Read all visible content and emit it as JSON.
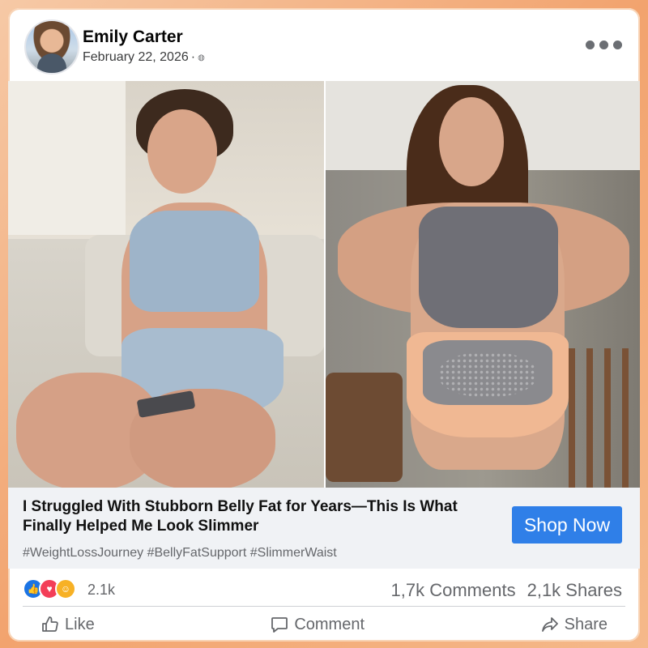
{
  "post": {
    "author": "Emily Carter",
    "date": "February 22, 2026",
    "privacy_icon": "globe-icon"
  },
  "ad": {
    "title": "I Struggled With Stubborn Belly Fat for Years—This Is What Finally Helped Me Look Slimmer",
    "hashtags": "#WeightLossJourney #BellyFatSupport #SlimmerWaist",
    "cta_label": "Shop Now"
  },
  "engagement": {
    "reaction_count": "2.1k",
    "comments": "1,7k Comments",
    "shares": "2,1k Shares"
  },
  "actions": {
    "like_label": "Like",
    "comment_label": "Comment",
    "share_label": "Share"
  },
  "colors": {
    "cta": "#2f7fe8",
    "like": "#1b74e4",
    "love": "#f33e58",
    "care": "#f7b125",
    "background_border": "#f2a36e"
  }
}
